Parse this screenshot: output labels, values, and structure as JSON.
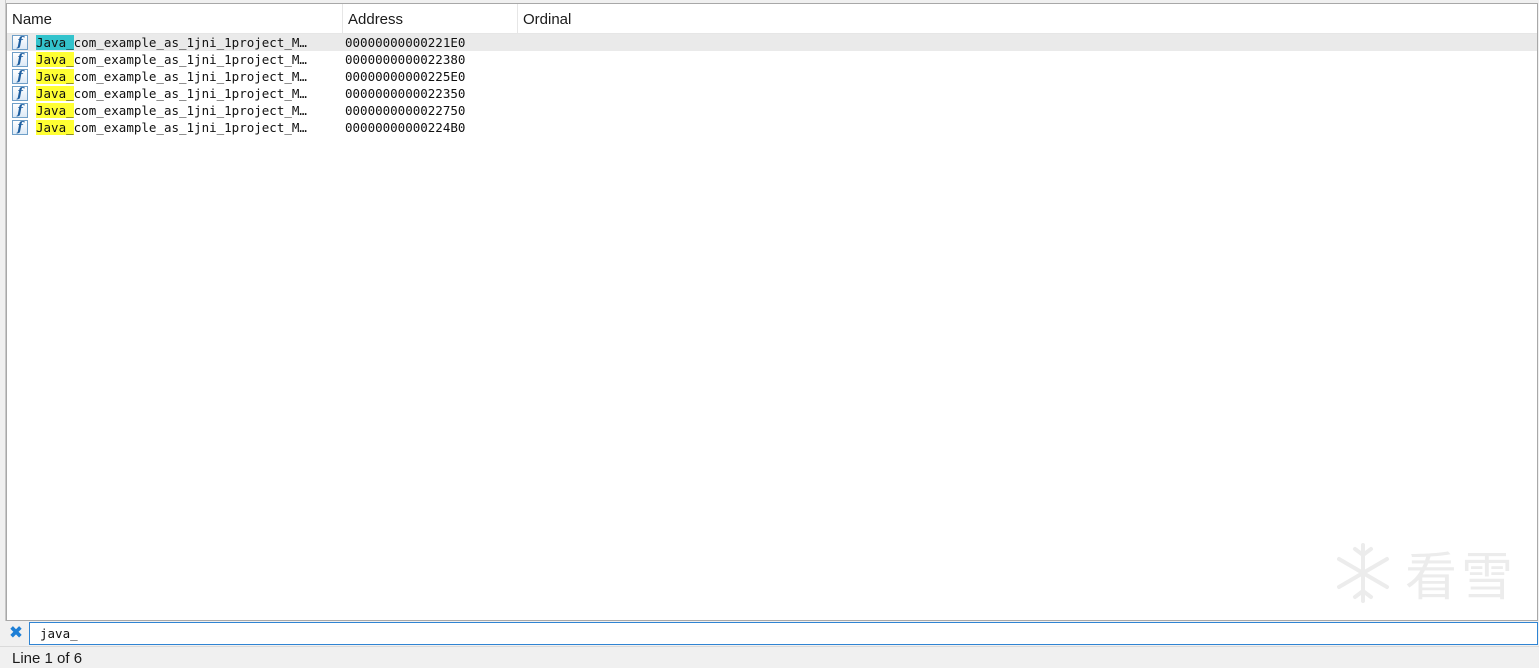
{
  "columns": {
    "name": "Name",
    "address": "Address",
    "ordinal": "Ordinal"
  },
  "rows": [
    {
      "match": "Java_",
      "rest": "com_example_as_1jni_1project_M…",
      "address": "00000000000221E0",
      "selected": true
    },
    {
      "match": "Java_",
      "rest": "com_example_as_1jni_1project_M…",
      "address": "0000000000022380",
      "selected": false
    },
    {
      "match": "Java_",
      "rest": "com_example_as_1jni_1project_M…",
      "address": "00000000000225E0",
      "selected": false
    },
    {
      "match": "Java_",
      "rest": "com_example_as_1jni_1project_M…",
      "address": "0000000000022350",
      "selected": false
    },
    {
      "match": "Java_",
      "rest": "com_example_as_1jni_1project_M…",
      "address": "0000000000022750",
      "selected": false
    },
    {
      "match": "Java_",
      "rest": "com_example_as_1jni_1project_M…",
      "address": "00000000000224B0",
      "selected": false
    }
  ],
  "icons": {
    "row_icon": "function-icon",
    "clear_filter": "close-icon",
    "watermark": "snowflake-logo-icon"
  },
  "colors": {
    "match_highlight": "#ffff33",
    "selected_match_highlight": "#33c3cc",
    "filter_border": "#2f84d3",
    "clear_icon": "#1e7fd6"
  },
  "filter": {
    "value": "java_"
  },
  "status": {
    "text": "Line 1 of 6"
  },
  "watermark": {
    "text": "看雪"
  }
}
